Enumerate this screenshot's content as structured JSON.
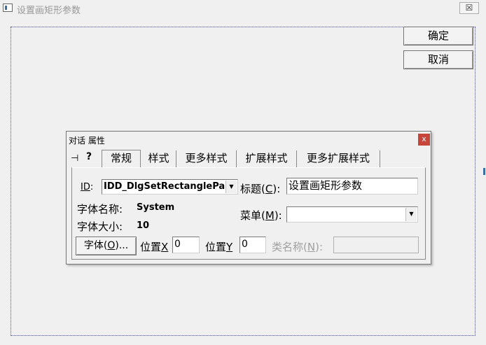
{
  "window": {
    "title": "设置画矩形参数",
    "close_glyph": "☒"
  },
  "dialog_buttons": {
    "ok": "确定",
    "cancel": "取消"
  },
  "props": {
    "title": "对话 属性",
    "close_glyph": "x",
    "pin_glyph": "⊣",
    "help_glyph": "?",
    "tabs": [
      "常规",
      "样式",
      "更多样式",
      "扩展样式",
      "更多扩展样式"
    ],
    "active_tab": "常规",
    "general": {
      "id_label_pre": "",
      "id_label_key": "ID",
      "id_label_post": ":",
      "id_value": "IDD_DlgSetRectanglePara",
      "caption_label_pre": "标题(",
      "caption_label_key": "C",
      "caption_label_post": "):",
      "caption_value": "设置画矩形参数",
      "font_name_label": "字体名称:",
      "font_name_value": "System",
      "font_size_label": "字体大小:",
      "font_size_value": "10",
      "menu_label_pre": "菜单(",
      "menu_label_key": "M",
      "menu_label_post": "):",
      "menu_value": "",
      "font_button_pre": "字体(",
      "font_button_key": "O",
      "font_button_post": ")...",
      "pos_x_label_pre": "位置",
      "pos_x_label_key": "X",
      "pos_x_value": "0",
      "pos_y_label_pre": "位置",
      "pos_y_label_key": "Y",
      "pos_y_value": "0",
      "class_label_pre": "类名称(",
      "class_label_key": "N",
      "class_label_post": "):",
      "class_value": ""
    }
  },
  "colors": {
    "frame_dotted": "#4c4c9c",
    "close_red": "#c7443a"
  }
}
